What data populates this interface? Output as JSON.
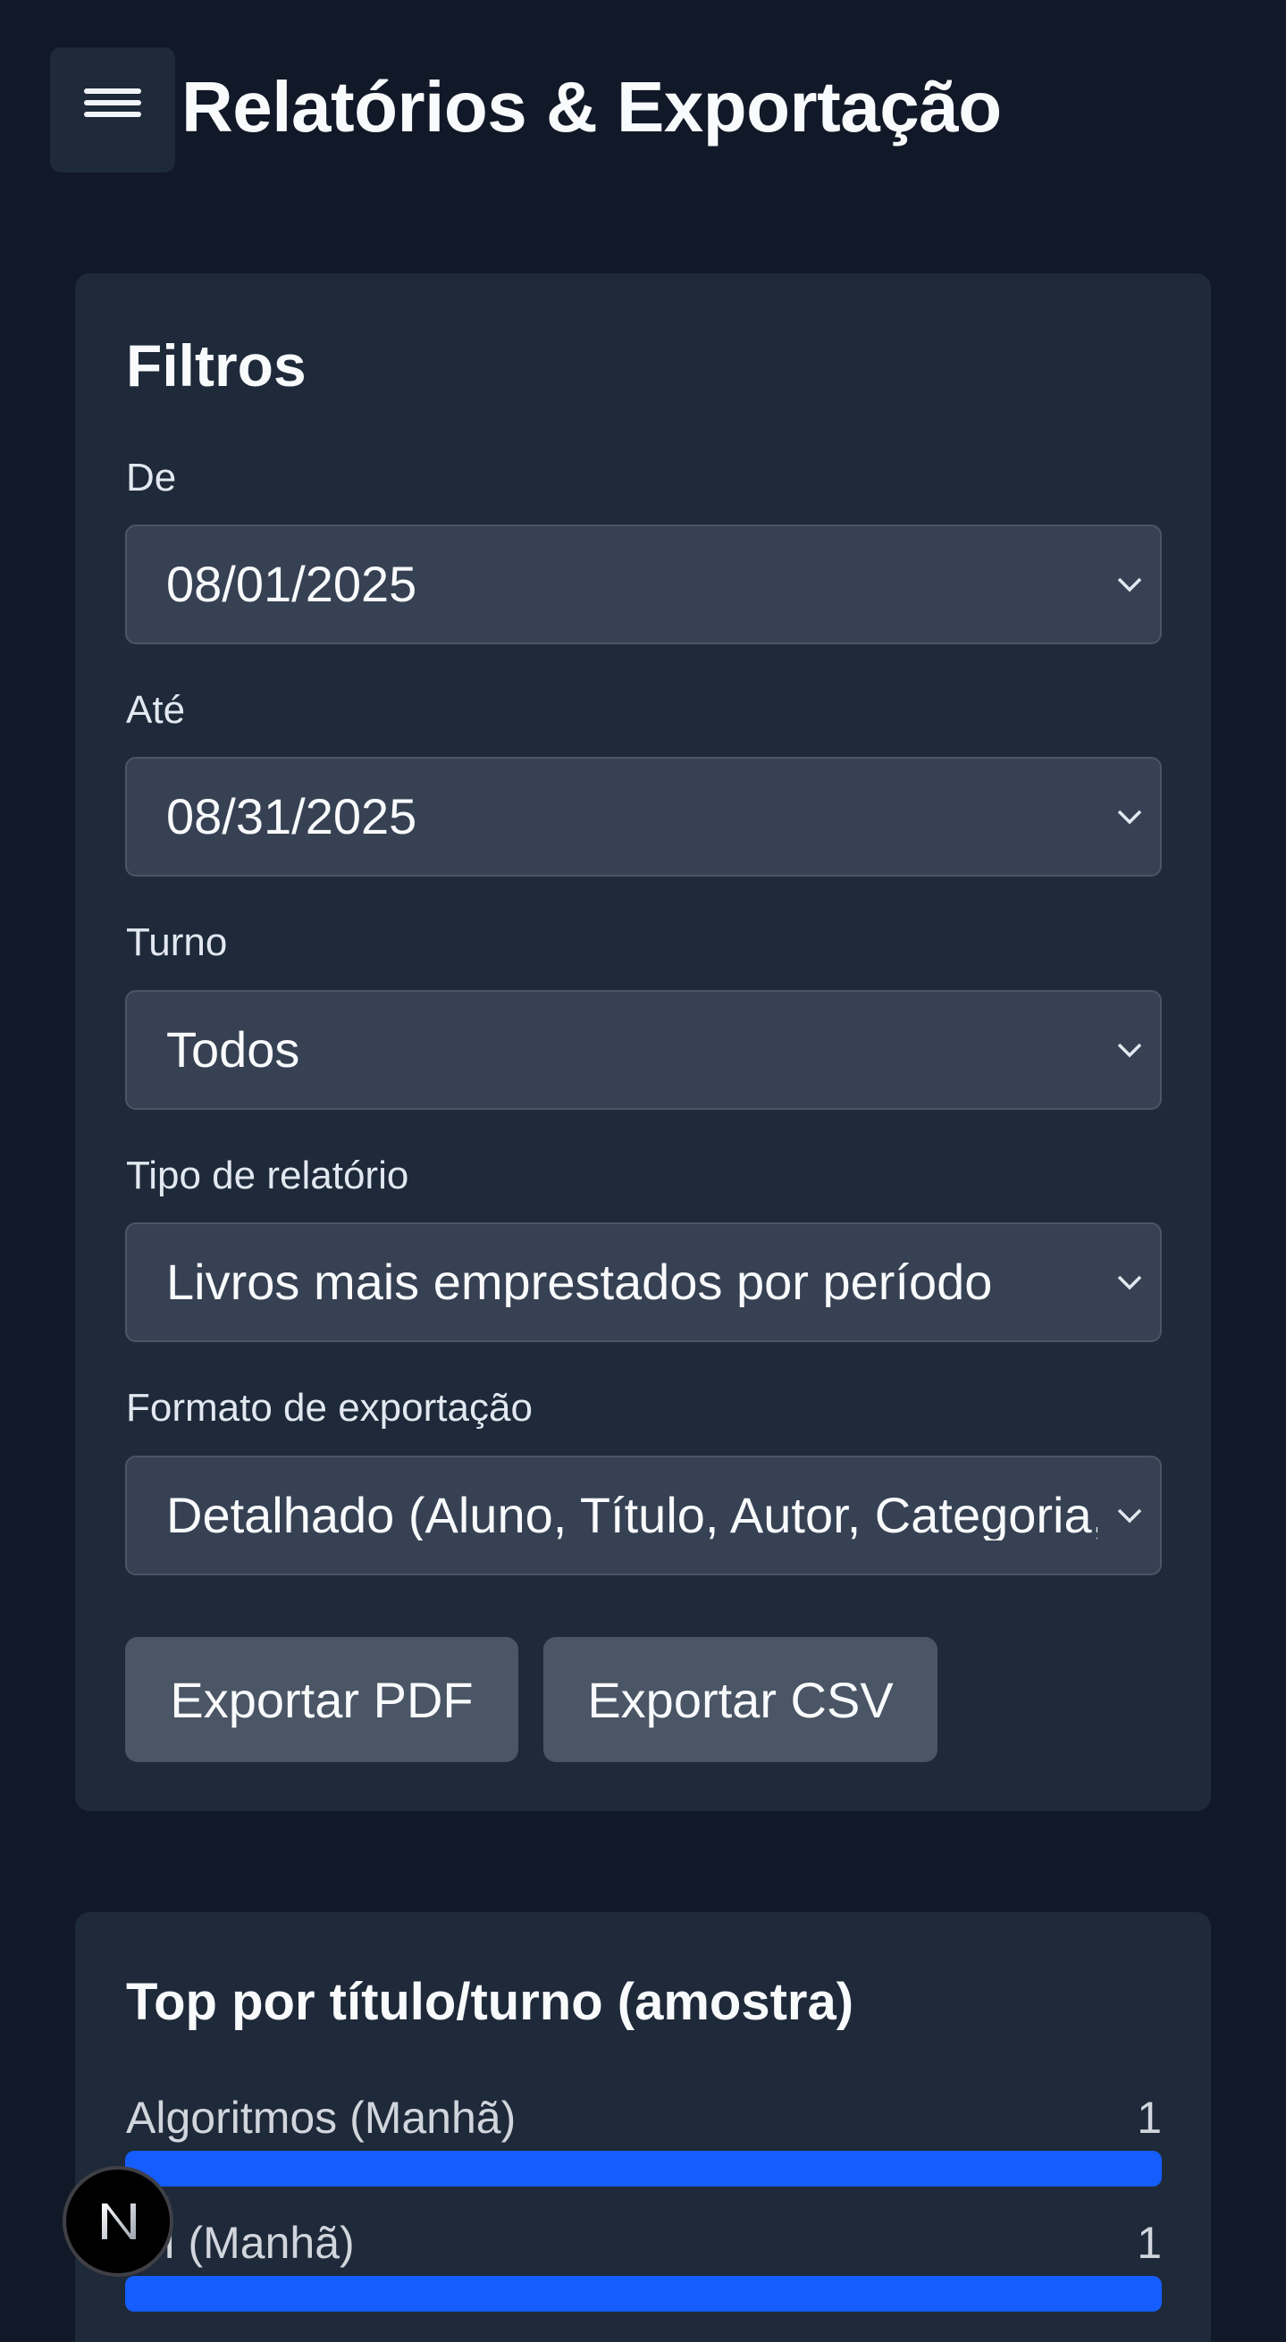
{
  "header": {
    "menu_icon": "hamburger-menu-icon",
    "title": "Relatórios & Exportação"
  },
  "filters": {
    "title": "Filtros",
    "from": {
      "label": "De",
      "value": "08/01/2025"
    },
    "to": {
      "label": "Até",
      "value": "08/31/2025"
    },
    "shift": {
      "label": "Turno",
      "value": "Todos"
    },
    "report_type": {
      "label": "Tipo de relatório",
      "value": "Livros mais emprestados por período"
    },
    "export_format": {
      "label": "Formato de exportação",
      "value": "Detalhado (Aluno, Título, Autor, Categoria,"
    },
    "export_pdf": "Exportar PDF",
    "export_csv": "Exportar CSV",
    "chevron_icon": "chevron-down-icon"
  },
  "top": {
    "title": "Top por título/turno (amostra)",
    "items": [
      {
        "label": "Algoritmos (Manhã)",
        "count": "1",
        "fill": 1.0
      },
      {
        "label": "o I (Manhã)",
        "count": "1",
        "fill": 1.0
      }
    ]
  },
  "colors": {
    "background": "#111827",
    "card": "#1e2939",
    "input": "#364153",
    "button": "#4a5565",
    "accent": "#155dfc"
  },
  "badge": {
    "letter": "N",
    "icon": "nextjs-logo-icon"
  }
}
